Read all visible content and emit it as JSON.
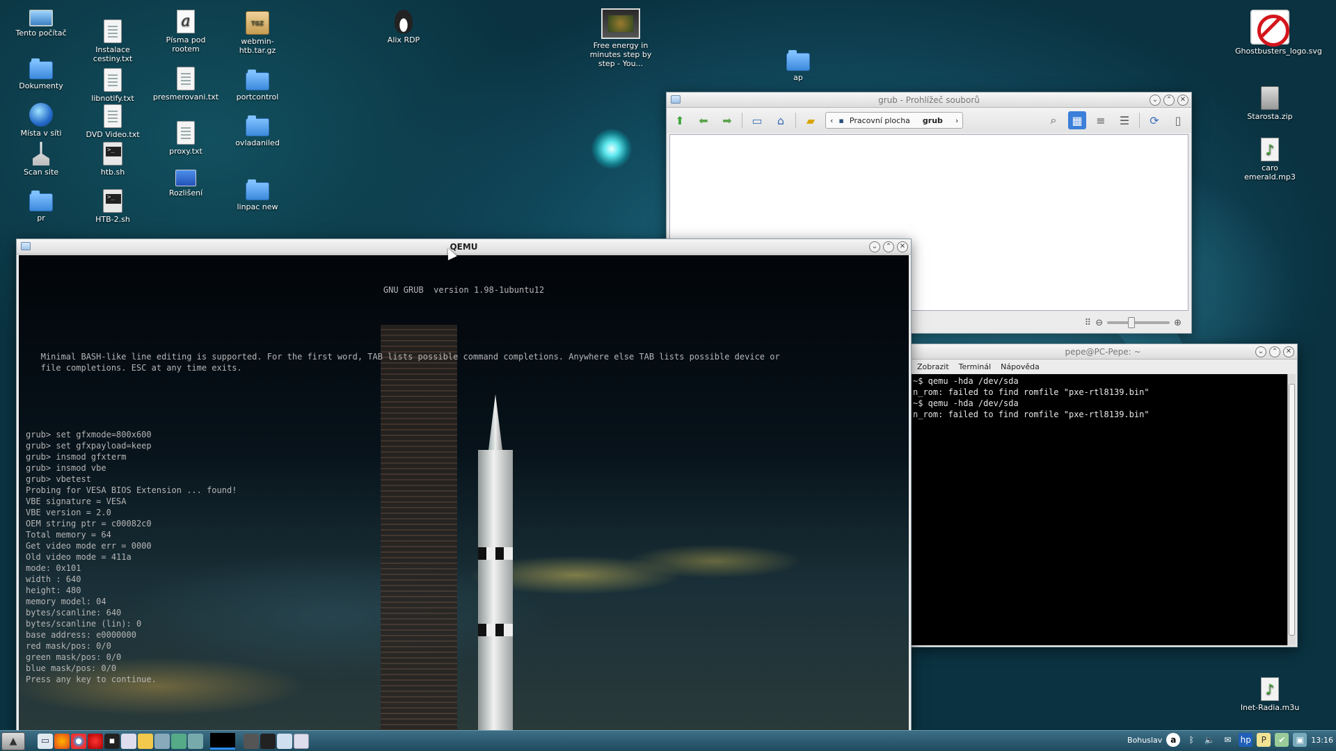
{
  "desktop": {
    "icons": [
      {
        "label": "Tento počítač",
        "icon": "computer-icon"
      },
      {
        "label": "Dokumenty",
        "icon": "folder-icon"
      },
      {
        "label": "Místa v síti",
        "icon": "network-globe-icon"
      },
      {
        "label": "Scan site",
        "icon": "scan-icon"
      },
      {
        "label": "pr",
        "icon": "folder-icon"
      },
      {
        "label": "Instalace cestiny.txt",
        "icon": "text-file-icon"
      },
      {
        "label": "libnotify.txt",
        "icon": "text-file-icon"
      },
      {
        "label": "DVD Video.txt",
        "icon": "text-file-icon"
      },
      {
        "label": "htb.sh",
        "icon": "shell-script-icon"
      },
      {
        "label": "HTB-2.sh",
        "icon": "shell-script-icon"
      },
      {
        "label": "Písma pod rootem",
        "icon": "font-icon"
      },
      {
        "label": "presmerovani.txt",
        "icon": "text-file-icon"
      },
      {
        "label": "proxy.txt",
        "icon": "text-file-icon"
      },
      {
        "label": "Rozlišení",
        "icon": "display-icon"
      },
      {
        "label": "webmin-htb.tar.gz",
        "icon": "archive-tgz-icon"
      },
      {
        "label": "portcontrol",
        "icon": "folder-icon"
      },
      {
        "label": "ovladaniled",
        "icon": "folder-icon"
      },
      {
        "label": "linpac new",
        "icon": "folder-icon"
      },
      {
        "label": "Alix RDP",
        "icon": "penguin-icon"
      },
      {
        "label": "Free energy in minutes step by step - You...",
        "icon": "video-file-icon"
      },
      {
        "label": "ap",
        "icon": "folder-icon"
      },
      {
        "label": "Ghostbusters_logo.svg",
        "icon": "ghostbusters-logo-icon"
      },
      {
        "label": "Starosta.zip",
        "icon": "zip-file-icon"
      },
      {
        "label": "caro emerald.mp3",
        "icon": "music-file-icon"
      },
      {
        "label": "Inet-Radia.m3u",
        "icon": "music-file-icon"
      }
    ]
  },
  "file_viewer": {
    "title": "grub - Prohlížeč souborů",
    "breadcrumb": [
      "Pracovní plocha",
      "grub"
    ]
  },
  "qemu": {
    "title": "QEMU",
    "header": "GNU GRUB  version 1.98-1ubuntu12",
    "intro_lines": [
      "   Minimal BASH-like line editing is supported. For the first word, TAB lists possible command completions. Anywhere else TAB lists possible device or",
      "   file completions. ESC at any time exits."
    ],
    "console_lines": [
      "grub> set gfxmode=800x600",
      "grub> set gfxpayload=keep",
      "grub> insmod gfxterm",
      "grub> insmod vbe",
      "grub> vbetest",
      "Probing for VESA BIOS Extension ... found!",
      "VBE signature = VESA",
      "VBE version = 2.0",
      "OEM string ptr = c00082c0",
      "Total memory = 64",
      "Get video mode err = 0000",
      "Old video mode = 411a",
      "mode: 0x101",
      "width : 640",
      "height: 480",
      "memory model: 04",
      "bytes/scanline: 640",
      "bytes/scanline (lin): 0",
      "base address: e0000000",
      "red mask/pos: 0/0",
      "green mask/pos: 0/0",
      "blue mask/pos: 0/0",
      "Press any key to continue."
    ]
  },
  "terminal": {
    "title": "pepe@PC-Pepe: ~",
    "menu": [
      "Zobrazit",
      "Terminál",
      "Nápověda"
    ],
    "lines": [
      "~$ qemu -hda /dev/sda",
      "n_rom: failed to find romfile \"pxe-rtl8139.bin\"",
      "~$ qemu -hda /dev/sda",
      "n_rom: failed to find romfile \"pxe-rtl8139.bin\""
    ]
  },
  "taskbar": {
    "user": "Bohuslav",
    "clock": "13:16"
  }
}
